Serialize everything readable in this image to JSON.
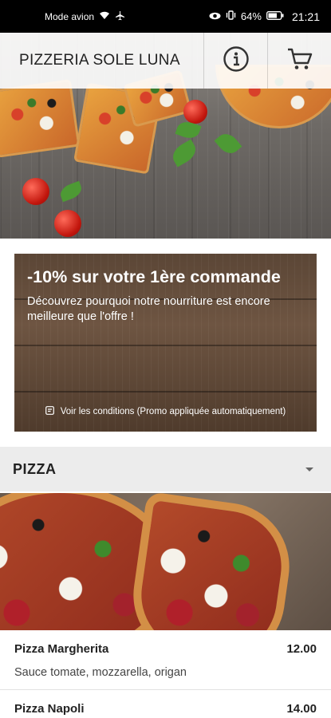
{
  "status_bar": {
    "network_label": "Mode avion",
    "battery": "64%",
    "time": "21:21"
  },
  "header": {
    "title": "PIZZERIA SOLE LUNA",
    "info_icon": "info-icon",
    "cart_icon": "cart-icon"
  },
  "promo": {
    "title": "-10% sur votre 1ère commande",
    "text": "Découvrez pourquoi notre nourriture est encore meilleure que l'offre !",
    "conditions": "Voir les conditions (Promo appliquée automatiquement)"
  },
  "section": {
    "title": "PIZZA",
    "chevron_icon": "chevron-down-icon"
  },
  "menu_items": [
    {
      "name": "Pizza Margherita",
      "price": "12.00",
      "description": "Sauce tomate, mozzarella, origan"
    },
    {
      "name": "Pizza Napoli",
      "price": "14.00",
      "description": ""
    }
  ]
}
